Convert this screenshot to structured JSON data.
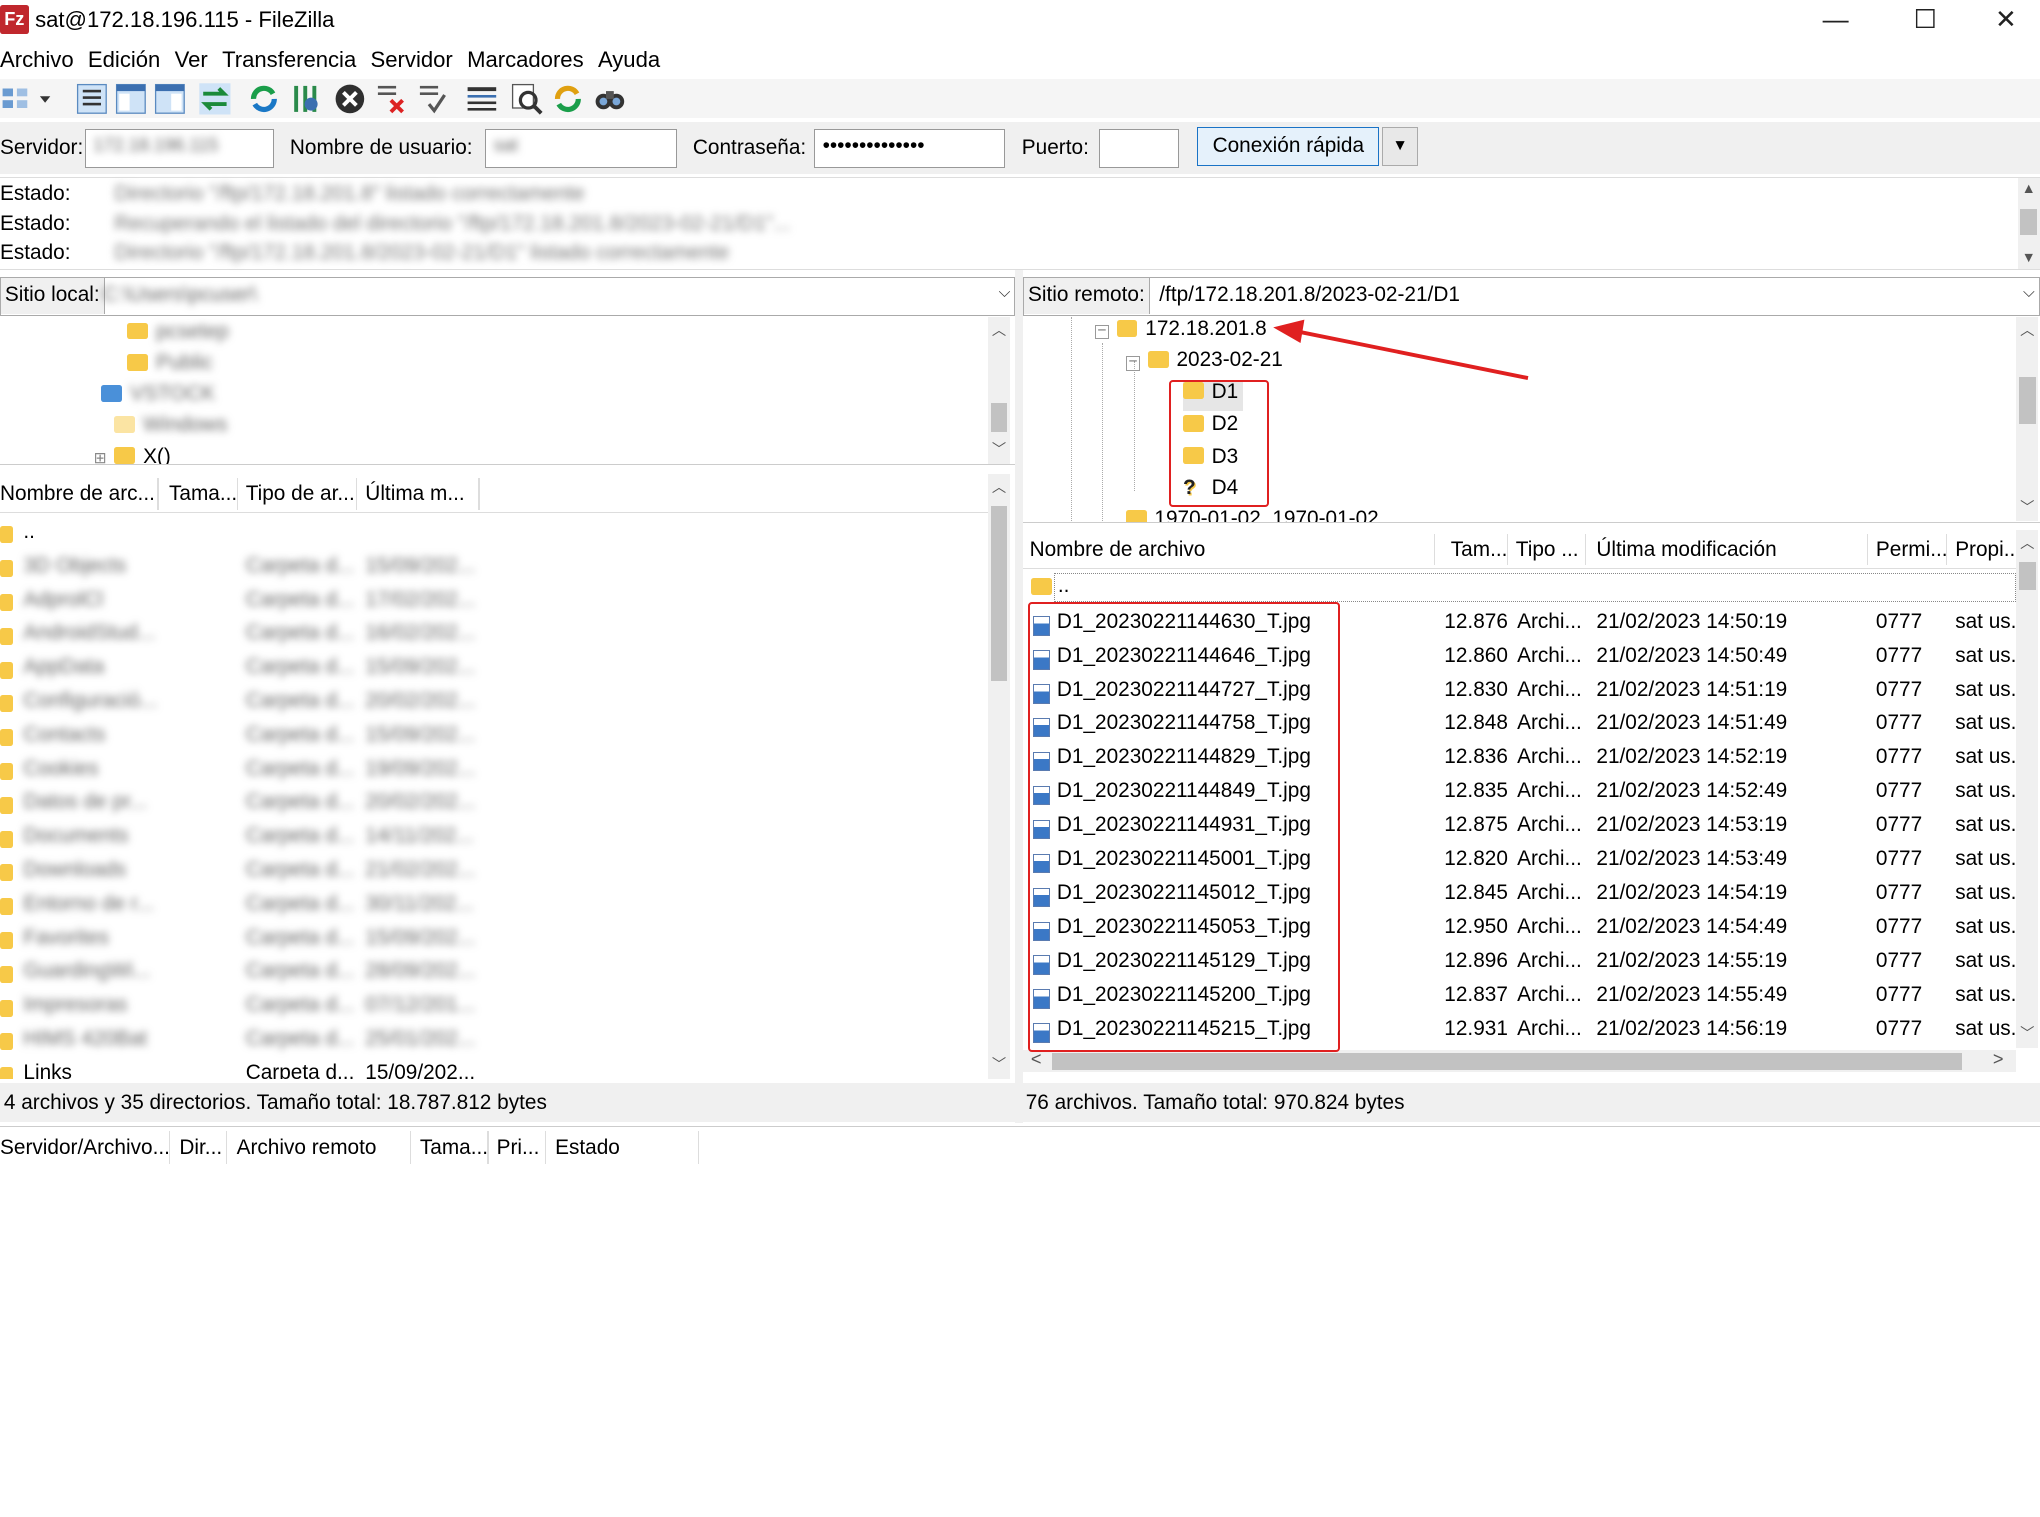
{
  "window": {
    "title": "sat@172.18.196.115 - FileZilla",
    "logo": "Fz",
    "controls": [
      "—",
      "☐",
      "✕"
    ]
  },
  "menu": [
    "Archivo",
    "Edición",
    "Ver",
    "Transferencia",
    "Servidor",
    "Marcadores",
    "Ayuda"
  ],
  "toolbar_icons": [
    "site-manager-icon",
    "dropdown-arrow-icon",
    "toggle-log-icon",
    "toggle-local-tree-icon",
    "toggle-remote-tree-icon",
    "toggle-queue-icon",
    "refresh-icon",
    "process-queue-icon",
    "cancel-icon",
    "disconnect-icon",
    "reconnect-icon",
    "filter-icon",
    "toggle-compare-icon",
    "sync-browse-icon",
    "search-icon"
  ],
  "quickconnect": {
    "server_label": "Servidor:",
    "server_value": "172.18.196.115",
    "user_label": "Nombre de usuario:",
    "user_value": "sat",
    "password_label": "Contraseña:",
    "password_value": "••••••••••••••",
    "port_label": "Puerto:",
    "port_value": "",
    "connect_label": "Conexión rápida",
    "dropdown": "▼"
  },
  "log": [
    {
      "label": "Estado:",
      "message": "Directorio \"/ftp/172.18.201.8\" listado correctamente"
    },
    {
      "label": "Estado:",
      "message": "Recuperando el listado del directorio \"/ftp/172.18.201.8/2023-02-21/D1\"..."
    },
    {
      "label": "Estado:",
      "message": "Directorio \"/ftp/172.18.201.8/2023-02-21/D1\" listado correctamente"
    }
  ],
  "local": {
    "site_label": "Sitio local:",
    "site_value": "C:\\Users\\pcuser\\",
    "tree": [
      {
        "name": "pcsetep",
        "blur": true
      },
      {
        "name": "Public",
        "blur": true
      },
      {
        "name": "VSTOCK",
        "blur": true
      },
      {
        "name": "Windows",
        "blur": true
      },
      {
        "name": "X()",
        "blur": false
      }
    ],
    "columns": [
      "Nombre de arc...",
      "Tama...",
      "Tipo de ar...",
      "Última m..."
    ],
    "files": [
      {
        "name": "..",
        "type": "",
        "date": "",
        "blur": false
      },
      {
        "name": "3D Objects",
        "type": "Carpeta d...",
        "date": "15/09/202...",
        "blur": true
      },
      {
        "name": "AdprolCl",
        "type": "Carpeta d...",
        "date": "17/02/202...",
        "blur": true
      },
      {
        "name": "AndroidStud...",
        "type": "Carpeta d...",
        "date": "16/02/202...",
        "blur": true
      },
      {
        "name": "AppData",
        "type": "Carpeta d...",
        "date": "15/09/202...",
        "blur": true
      },
      {
        "name": "Configuració...",
        "type": "Carpeta d...",
        "date": "20/02/202...",
        "blur": true
      },
      {
        "name": "Contacts",
        "type": "Carpeta d...",
        "date": "15/09/202...",
        "blur": true
      },
      {
        "name": "Cookies",
        "type": "Carpeta d...",
        "date": "19/09/202...",
        "blur": true
      },
      {
        "name": "Datos de pr...",
        "type": "Carpeta d...",
        "date": "20/02/202...",
        "blur": true
      },
      {
        "name": "Documents",
        "type": "Carpeta d...",
        "date": "14/11/202...",
        "blur": true
      },
      {
        "name": "Downloads",
        "type": "Carpeta d...",
        "date": "21/02/202...",
        "blur": true
      },
      {
        "name": "Entorno de r...",
        "type": "Carpeta d...",
        "date": "30/11/202...",
        "blur": true
      },
      {
        "name": "Favorites",
        "type": "Carpeta d...",
        "date": "15/09/202...",
        "blur": true
      },
      {
        "name": "GuardingWi...",
        "type": "Carpeta d...",
        "date": "28/09/202...",
        "blur": true
      },
      {
        "name": "Impresoras",
        "type": "Carpeta d...",
        "date": "07/12/201...",
        "blur": true
      },
      {
        "name": "HIMS 420Bat",
        "type": "Carpeta d...",
        "date": "25/01/202...",
        "blur": true
      },
      {
        "name": "Links",
        "type": "Carpeta d...",
        "date": "15/09/202...",
        "blur": false
      }
    ],
    "status": "4 archivos y 35 directorios. Tamaño total: 18.787.812 bytes"
  },
  "remote": {
    "site_label": "Sitio remoto:",
    "site_value": "/ftp/172.18.201.8/2023-02-21/D1",
    "tree": [
      {
        "name": "172.18.201.8",
        "icon": "folder",
        "toggle": "−"
      },
      {
        "name": "2023-02-21",
        "icon": "folder",
        "toggle": "−"
      },
      {
        "name": "D1",
        "icon": "folder",
        "toggle": ""
      },
      {
        "name": "D2",
        "icon": "folder",
        "toggle": ""
      },
      {
        "name": "D3",
        "icon": "folder",
        "toggle": ""
      },
      {
        "name": "D4",
        "icon": "unknown",
        "toggle": ""
      },
      {
        "name": "1970-01-02_1970-01-02",
        "icon": "folder",
        "toggle": ""
      }
    ],
    "columns": [
      "Nombre de archivo",
      "Tam...",
      "Tipo ...",
      "Última modificación",
      "Permi...",
      "Propi..."
    ],
    "parent_row": "..",
    "files": [
      {
        "name": "D1_20230221144630_T.jpg",
        "size": "12.876",
        "type": "Archi...",
        "date": "21/02/2023 14:50:19",
        "perm": "0777",
        "owner": "sat us."
      },
      {
        "name": "D1_20230221144646_T.jpg",
        "size": "12.860",
        "type": "Archi...",
        "date": "21/02/2023 14:50:49",
        "perm": "0777",
        "owner": "sat us."
      },
      {
        "name": "D1_20230221144727_T.jpg",
        "size": "12.830",
        "type": "Archi...",
        "date": "21/02/2023 14:51:19",
        "perm": "0777",
        "owner": "sat us."
      },
      {
        "name": "D1_20230221144758_T.jpg",
        "size": "12.848",
        "type": "Archi...",
        "date": "21/02/2023 14:51:49",
        "perm": "0777",
        "owner": "sat us."
      },
      {
        "name": "D1_20230221144829_T.jpg",
        "size": "12.836",
        "type": "Archi...",
        "date": "21/02/2023 14:52:19",
        "perm": "0777",
        "owner": "sat us."
      },
      {
        "name": "D1_20230221144849_T.jpg",
        "size": "12.835",
        "type": "Archi...",
        "date": "21/02/2023 14:52:49",
        "perm": "0777",
        "owner": "sat us."
      },
      {
        "name": "D1_20230221144931_T.jpg",
        "size": "12.875",
        "type": "Archi...",
        "date": "21/02/2023 14:53:19",
        "perm": "0777",
        "owner": "sat us."
      },
      {
        "name": "D1_20230221145001_T.jpg",
        "size": "12.820",
        "type": "Archi...",
        "date": "21/02/2023 14:53:49",
        "perm": "0777",
        "owner": "sat us."
      },
      {
        "name": "D1_20230221145012_T.jpg",
        "size": "12.845",
        "type": "Archi...",
        "date": "21/02/2023 14:54:19",
        "perm": "0777",
        "owner": "sat us."
      },
      {
        "name": "D1_20230221145053_T.jpg",
        "size": "12.950",
        "type": "Archi...",
        "date": "21/02/2023 14:54:49",
        "perm": "0777",
        "owner": "sat us."
      },
      {
        "name": "D1_20230221145129_T.jpg",
        "size": "12.896",
        "type": "Archi...",
        "date": "21/02/2023 14:55:19",
        "perm": "0777",
        "owner": "sat us."
      },
      {
        "name": "D1_20230221145200_T.jpg",
        "size": "12.837",
        "type": "Archi...",
        "date": "21/02/2023 14:55:49",
        "perm": "0777",
        "owner": "sat us."
      },
      {
        "name": "D1_20230221145215_T.jpg",
        "size": "12.931",
        "type": "Archi...",
        "date": "21/02/2023 14:56:19",
        "perm": "0777",
        "owner": "sat us."
      }
    ],
    "status": "76 archivos. Tamaño total: 970.824 bytes"
  },
  "queue_columns": [
    "Servidor/Archivo...",
    "Dir...",
    "Archivo remoto",
    "Tama...",
    "Pri...",
    "Estado"
  ],
  "colors": {
    "annotation_red": "#e02020",
    "folder_yellow": "#f7c948",
    "button_blue": "#1a73c6"
  }
}
